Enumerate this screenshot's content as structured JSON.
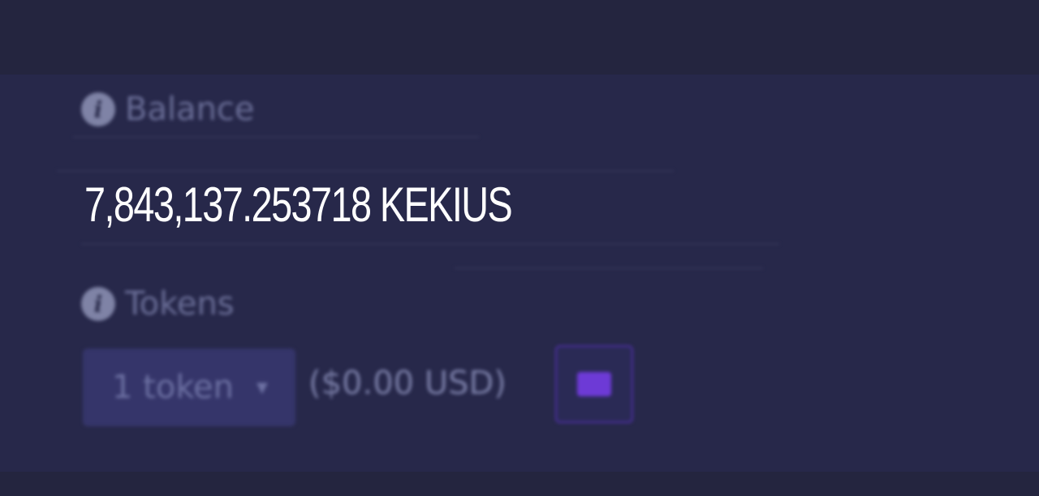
{
  "balance": {
    "label": "Balance",
    "amount": "7,843,137.253718 KEKIUS"
  },
  "tokens": {
    "label": "Tokens",
    "select_value": "1 token",
    "usd_value": "($0.00 USD)"
  },
  "icons": {
    "info": "info-icon",
    "dropdown": "chevron-down-icon",
    "wallet": "wallet-icon"
  },
  "colors": {
    "background": "#24253f",
    "accent": "#6d3ad6",
    "amount_text": "#ffffff"
  }
}
